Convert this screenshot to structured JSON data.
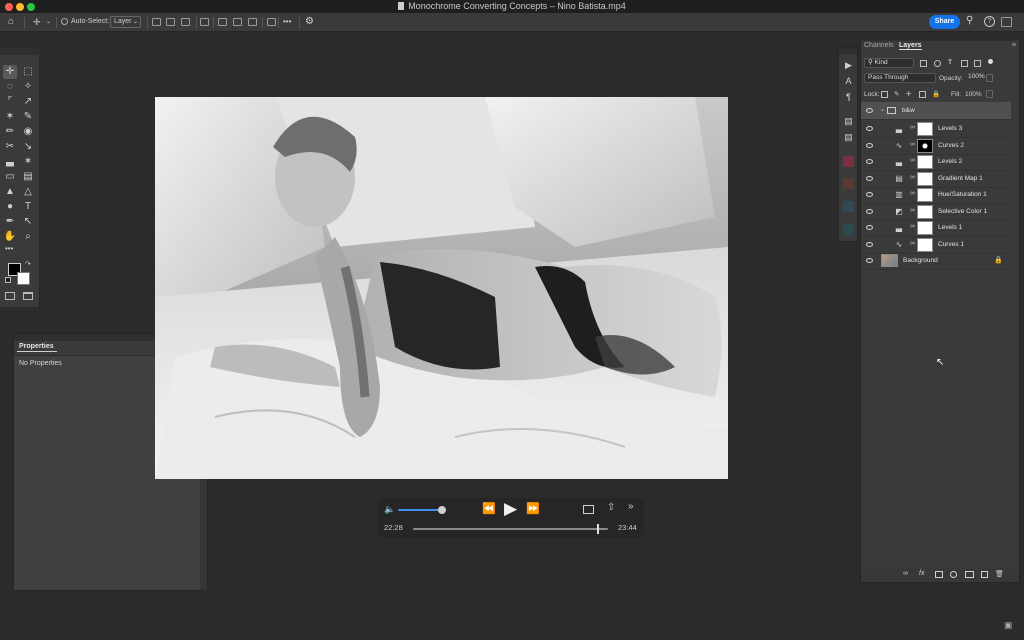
{
  "window": {
    "title": "Monochrome Converting Concepts – Nino Batista.mp4",
    "traffic_lights": [
      "#ff5f57",
      "#febc2e",
      "#28c840"
    ]
  },
  "options_bar": {
    "auto_select_label": "Auto-Select:",
    "auto_select_value": "Layer",
    "more_label": "•••",
    "share_label": "Share",
    "accent_color": "#1473e6"
  },
  "toolbar": {
    "more_label": "•••",
    "tools": [
      {
        "name": "move-tool-icon",
        "glyph": "✛"
      },
      {
        "name": "marquee-tool-icon",
        "glyph": "⬚"
      },
      {
        "name": "lasso-tool-icon",
        "glyph": "◌"
      },
      {
        "name": "magic-wand-tool-icon",
        "glyph": "✧"
      },
      {
        "name": "crop-tool-icon",
        "glyph": "⌜"
      },
      {
        "name": "eyedropper-tool-icon",
        "glyph": "↗"
      },
      {
        "name": "spot-healing-tool-icon",
        "glyph": "✶"
      },
      {
        "name": "brush-tool-icon",
        "glyph": "✎"
      },
      {
        "name": "pencil-tool-icon",
        "glyph": "✏"
      },
      {
        "name": "stamp-tool-icon",
        "glyph": "◉"
      },
      {
        "name": "history-brush-icon",
        "glyph": "✂"
      },
      {
        "name": "art-brush-icon",
        "glyph": "↘"
      },
      {
        "name": "clone-stamp-icon",
        "glyph": "▃"
      },
      {
        "name": "smudge-tool-icon",
        "glyph": "✶"
      },
      {
        "name": "eraser-tool-icon",
        "glyph": "▭"
      },
      {
        "name": "gradient-tool-icon",
        "glyph": "▤"
      },
      {
        "name": "blur-tool-icon",
        "glyph": "▲"
      },
      {
        "name": "sharpen-tool-icon",
        "glyph": "△"
      },
      {
        "name": "dodge-tool-icon",
        "glyph": "●"
      },
      {
        "name": "type-tool-icon",
        "glyph": "T"
      },
      {
        "name": "pen-tool-icon",
        "glyph": "✒"
      },
      {
        "name": "path-selection-icon",
        "glyph": "↖"
      },
      {
        "name": "hand-tool-icon",
        "glyph": "✋"
      },
      {
        "name": "zoom-tool-icon",
        "glyph": "⌕"
      }
    ]
  },
  "properties": {
    "tab": "Properties",
    "body": "No Properties"
  },
  "video": {
    "current_time": "22:28",
    "total_time": "23:44",
    "volume_level": 0.7,
    "progress": 0.946
  },
  "layers_panel": {
    "tabs": [
      "Channels",
      "Layers"
    ],
    "filter_value": "Kind",
    "blend_mode": "Pass Through",
    "opacity_label": "Opacity:",
    "opacity_value": "100%",
    "lock_label": "Lock:",
    "fill_label": "Fill:",
    "fill_value": "100%",
    "group_name": "b&w",
    "layers": [
      {
        "name": "Levels 3",
        "icon": "levels-icon",
        "glyph": "▃"
      },
      {
        "name": "Curves 2",
        "icon": "curves-icon",
        "glyph": "∿"
      },
      {
        "name": "Levels 2",
        "icon": "levels-icon",
        "glyph": "▃"
      },
      {
        "name": "Gradient Map 1",
        "icon": "gradient-map-icon",
        "glyph": "▤"
      },
      {
        "name": "Hue/Saturation 1",
        "icon": "hue-saturation-icon",
        "glyph": "▥"
      },
      {
        "name": "Selective Color 1",
        "icon": "selective-color-icon",
        "glyph": "◩"
      },
      {
        "name": "Levels 1",
        "icon": "levels-icon",
        "glyph": "▃"
      },
      {
        "name": "Curves 1",
        "icon": "curves-icon",
        "glyph": "∿"
      }
    ],
    "background_name": "Background"
  }
}
